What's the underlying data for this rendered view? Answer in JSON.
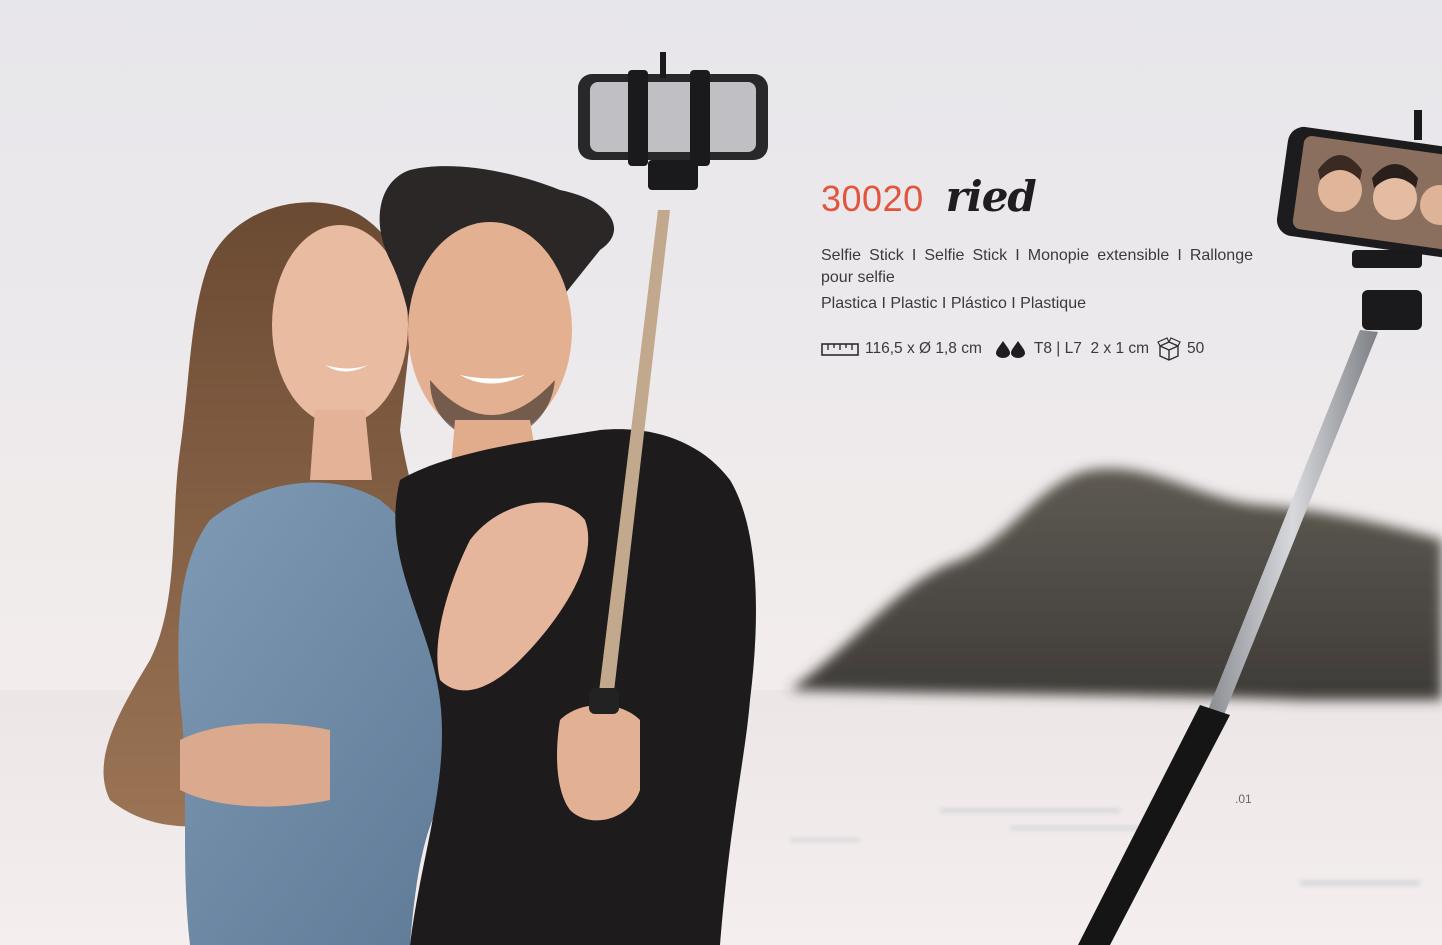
{
  "product": {
    "code": "30020",
    "name": "ried",
    "description": "Selfie Stick I Selfie Stick I Monopie extensible I Rallonge pour selfie",
    "material": "Plastica I Plastic I Plástico I Plastique",
    "dimensions": "116,5 x Ø 1,8 cm",
    "print": "T8 | L7  2 x 1 cm",
    "package_qty": "50"
  },
  "page_number": ".01",
  "icons": [
    "ruler-icon",
    "ink-drops-icon",
    "package-box-icon"
  ],
  "colors": {
    "accent": "#e2553d",
    "name": "#1f1d22",
    "text": "#3b393d"
  }
}
